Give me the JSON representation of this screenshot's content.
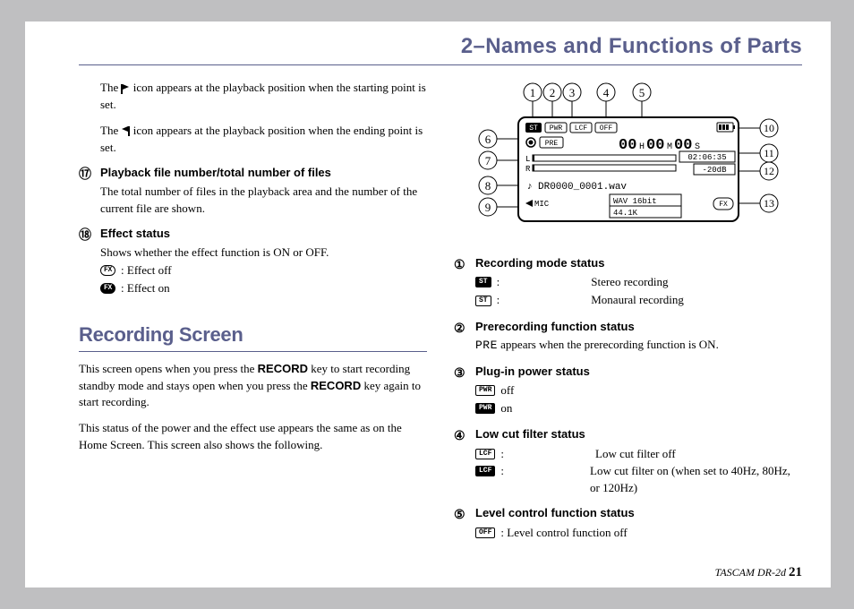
{
  "header": "2–Names and Functions of Parts",
  "left": {
    "p1a": "The ",
    "p1b": " icon appears at the playback position when the starting point is set.",
    "p2a": "The ",
    "p2b": " icon appears at the playback position when the ending point is set.",
    "item17": {
      "num": "⑰",
      "title": "Playback file number/total number of files",
      "body": "The total number of files in the playback area and the number of the current file are shown."
    },
    "item18": {
      "num": "⑱",
      "title": "Effect status",
      "body": "Shows whether the effect function is ON or OFF.",
      "off": " : Effect off",
      "on": " : Effect on"
    },
    "section": "Recording Screen",
    "p3a": "This screen opens when you press the ",
    "p3b": " key to start recording standby mode and stays open when you press the ",
    "p3c": " key again to start recording.",
    "record": "RECORD",
    "p4": "This status of the power and the effect use appears the same as on the Home Screen. This screen also shows the following."
  },
  "right": {
    "item1": {
      "num": "①",
      "title": "Recording mode status",
      "line1": "Stereo recording",
      "line2": "Monaural recording"
    },
    "item2": {
      "num": "②",
      "title": "Prerecording function status",
      "bodyA": "PRE",
      "bodyB": " appears when the prerecording function is ON."
    },
    "item3": {
      "num": "③",
      "title": "Plug-in power status",
      "off": " off",
      "on": " on"
    },
    "item4": {
      "num": "④",
      "title": "Low cut filter status",
      "offLabel": "Low cut filter off",
      "onLabel": "Low cut filter on (when set to 40Hz, 80Hz, or 120Hz)"
    },
    "item5": {
      "num": "⑤",
      "title": "Level control function status",
      "body": " : Level control function off"
    }
  },
  "icons": {
    "st": "ST",
    "fx": "FX",
    "pwr": "PWR",
    "lcf": "LCF",
    "off": "OFF"
  },
  "lcd": {
    "callouts": [
      "1",
      "2",
      "3",
      "4",
      "5",
      "6",
      "7",
      "8",
      "9",
      "10",
      "11",
      "12",
      "13"
    ],
    "time": "00H00M00S",
    "clock": "02:06:35",
    "db": "-20dB",
    "file": "DR0000_0001.wav",
    "mic": "MIC",
    "fmt": "WAV 16bit",
    "rate": "44.1K",
    "pre": "PRE",
    "fxtag": "FX"
  },
  "footer": {
    "model": "TASCAM  DR-2d ",
    "page": "21"
  }
}
